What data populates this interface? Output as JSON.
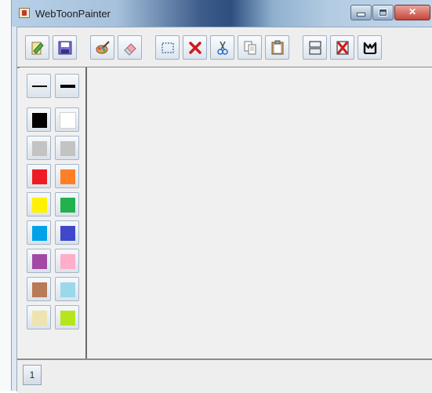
{
  "window": {
    "title": "WebToonPainter"
  },
  "toolbar": {
    "tools": [
      {
        "name": "open",
        "icon": "open-file-icon"
      },
      {
        "name": "save",
        "icon": "save-icon"
      },
      {
        "name": "brush",
        "icon": "brush-icon"
      },
      {
        "name": "eraser",
        "icon": "eraser-icon"
      },
      {
        "name": "select",
        "icon": "selection-icon"
      },
      {
        "name": "delete",
        "icon": "delete-icon"
      },
      {
        "name": "cut",
        "icon": "cut-icon"
      },
      {
        "name": "copy",
        "icon": "copy-icon"
      },
      {
        "name": "paste",
        "icon": "paste-icon"
      },
      {
        "name": "add-panel",
        "icon": "split-panel-icon"
      },
      {
        "name": "delete-panel",
        "icon": "delete-panel-icon"
      },
      {
        "name": "merge",
        "icon": "merge-icon"
      }
    ]
  },
  "palette": {
    "line_widths": [
      "thin",
      "thick"
    ],
    "colors": [
      "#000000",
      "#ffffff",
      "#c3c3c3",
      "#c3c3c3",
      "#ed1c24",
      "#ff7f27",
      "#fff200",
      "#22b14c",
      "#00a2e8",
      "#3f48cc",
      "#a349a4",
      "#ffaec9",
      "#b97a57",
      "#99d9ea",
      "#efe4b0",
      "#b5e61d"
    ]
  },
  "pages": {
    "current": "1"
  }
}
